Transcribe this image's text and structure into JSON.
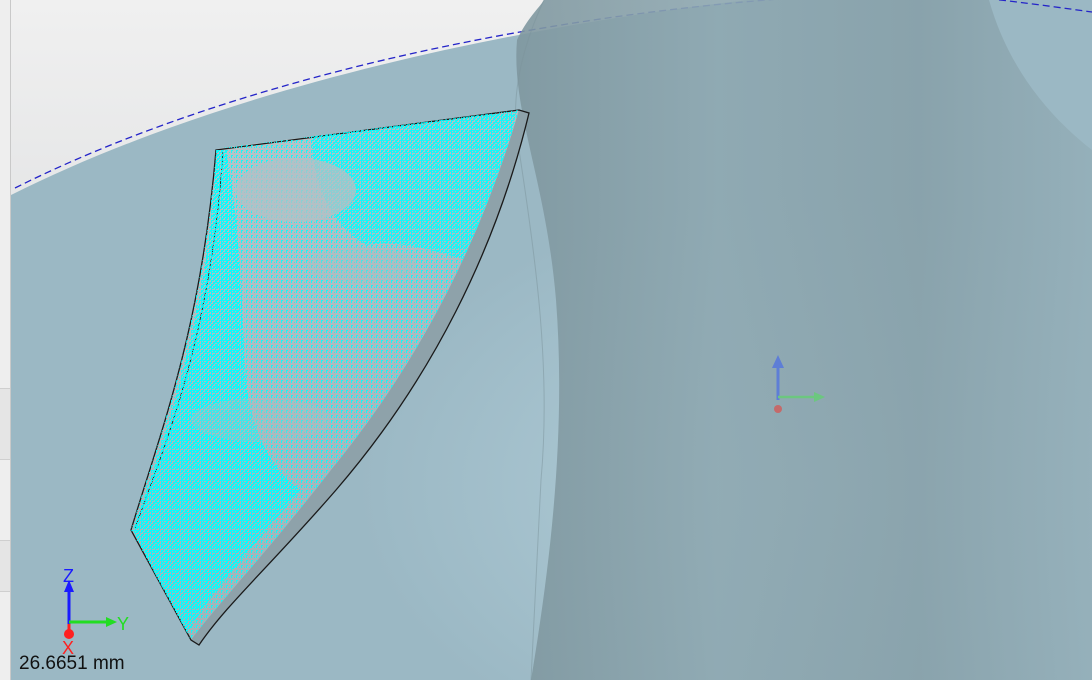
{
  "viewport": {
    "scale_readout": "26.6651 mm",
    "triad": {
      "z_label": "Z",
      "y_label": "Y",
      "x_label": "X",
      "z_color": "#1a1aff",
      "y_color": "#22dd22",
      "x_color": "#ff2020"
    },
    "colors": {
      "background_top": "#ececec",
      "background_bottom": "#d0d3d5",
      "hub_surface": "#9fbbc6",
      "blade_surface": "#a8b6bc",
      "point_cloud": "#00ffff",
      "boundary_circle": "#2424c8"
    }
  }
}
